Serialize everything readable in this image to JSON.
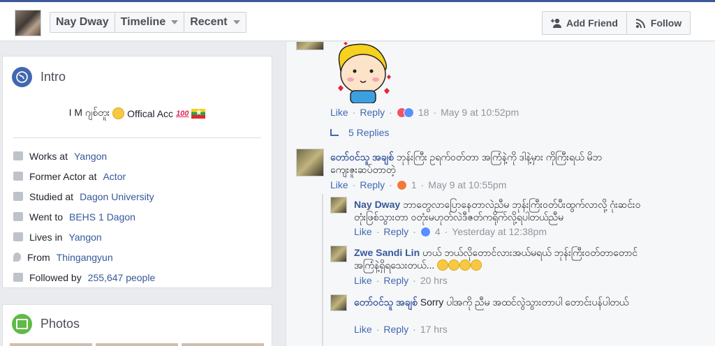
{
  "header": {
    "profile_name": "Nay Dway",
    "timeline_label": "Timeline",
    "recent_label": "Recent",
    "add_friend_label": "Add Friend",
    "follow_label": "Follow"
  },
  "intro": {
    "title": "Intro",
    "tagline": "I M ဂျစ်တူး",
    "tagline_suffix": "Offical Acc",
    "items": [
      {
        "icon": "briefcase-icon",
        "prefix": "Works at",
        "link": "Yangon"
      },
      {
        "icon": "briefcase-icon",
        "prefix": "Former Actor at",
        "link": "Actor"
      },
      {
        "icon": "graduation-cap-icon",
        "prefix": "Studied at",
        "link": "Dagon University"
      },
      {
        "icon": "graduation-cap-icon",
        "prefix": "Went to",
        "link": "BEHS 1 Dagon"
      },
      {
        "icon": "home-icon",
        "prefix": "Lives in",
        "link": "Yangon"
      },
      {
        "icon": "location-pin-icon",
        "prefix": "From",
        "link": "Thingangyun"
      },
      {
        "icon": "rss-icon",
        "prefix": "Followed by",
        "link": "255,647 people"
      }
    ]
  },
  "photos": {
    "title": "Photos"
  },
  "comments": {
    "c1": {
      "like": "Like",
      "reply": "Reply",
      "count": "18",
      "time": "May 9 at 10:52pm",
      "replies": "5 Replies"
    },
    "c2": {
      "name": "တော်ဝင်သူ အချစ်",
      "text": "ဘုန်းကြီး ဥရက်ဝတ်တာ အကြံနဲ့ကို ဒါနဲ့မှား ကိုကြီးရယ် မိဘကျေးဇူးဆပ်တာတဲ့",
      "like": "Like",
      "reply": "Reply",
      "count": "1",
      "time": "May 9 at 10:55pm"
    },
    "r1": {
      "name": "Nay Dway",
      "text": "ဘာတွေလာပြောနေတာလဲညီမ ဘုန်းကြီးဝတ်ပီးထွက်လာလို့ ဂုံးဆင်းဝတုံးဖြစ်သွားတာ ဝတုံးမဟုတ်လဲဒီဇတ်ကရိုက်လို့ရပါတယ်ညီမ",
      "like": "Like",
      "reply": "Reply",
      "count": "4",
      "time": "Yesterday at 12:38pm"
    },
    "r2": {
      "name": "Zwe Sandi Lin",
      "text": "ဟယ် ဘယ်လိုတောင်လားအယ်မရယ် ဘုန်းကြီးဝတ်တာတောင်အကြံနဲ့ရှိရသေးတယ်...",
      "like": "Like",
      "reply": "Reply",
      "time": "20 hrs"
    },
    "r3": {
      "name": "တော်ဝင်သူ အချစ်",
      "text": "Sorry ပါအကို ညီမ အထင်လွဲသွားတာပါ တောင်းပန်ပါတယ်",
      "like": "Like",
      "reply": "Reply",
      "time": "17 hrs"
    }
  },
  "colors": {
    "brand": "#3b5998",
    "link": "#365899",
    "muted": "#90949c"
  }
}
